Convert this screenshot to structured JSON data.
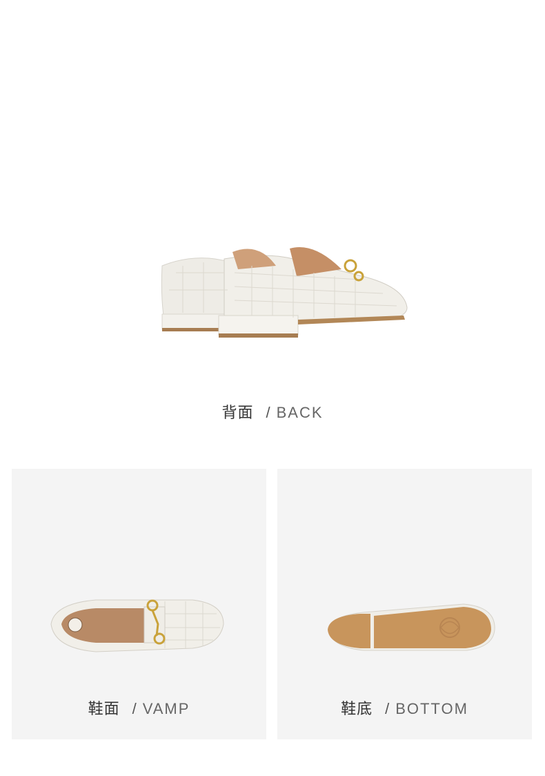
{
  "views": {
    "back": {
      "label_zh": "背面",
      "separator": "/",
      "label_en": "BACK",
      "image": "white-croc-loafer-back-view"
    },
    "vamp": {
      "label_zh": "鞋面",
      "separator": "/",
      "label_en": "VAMP",
      "image": "white-croc-loafer-top-view"
    },
    "bottom": {
      "label_zh": "鞋底",
      "separator": "/",
      "label_en": "BOTTOM",
      "image": "loafer-tan-outsole-view"
    }
  },
  "colors": {
    "background": "#ffffff",
    "panel": "#f4f4f4",
    "leather": "#f1efe9",
    "hardware_gold": "#c9a23a",
    "sole_tan": "#c8955c"
  }
}
